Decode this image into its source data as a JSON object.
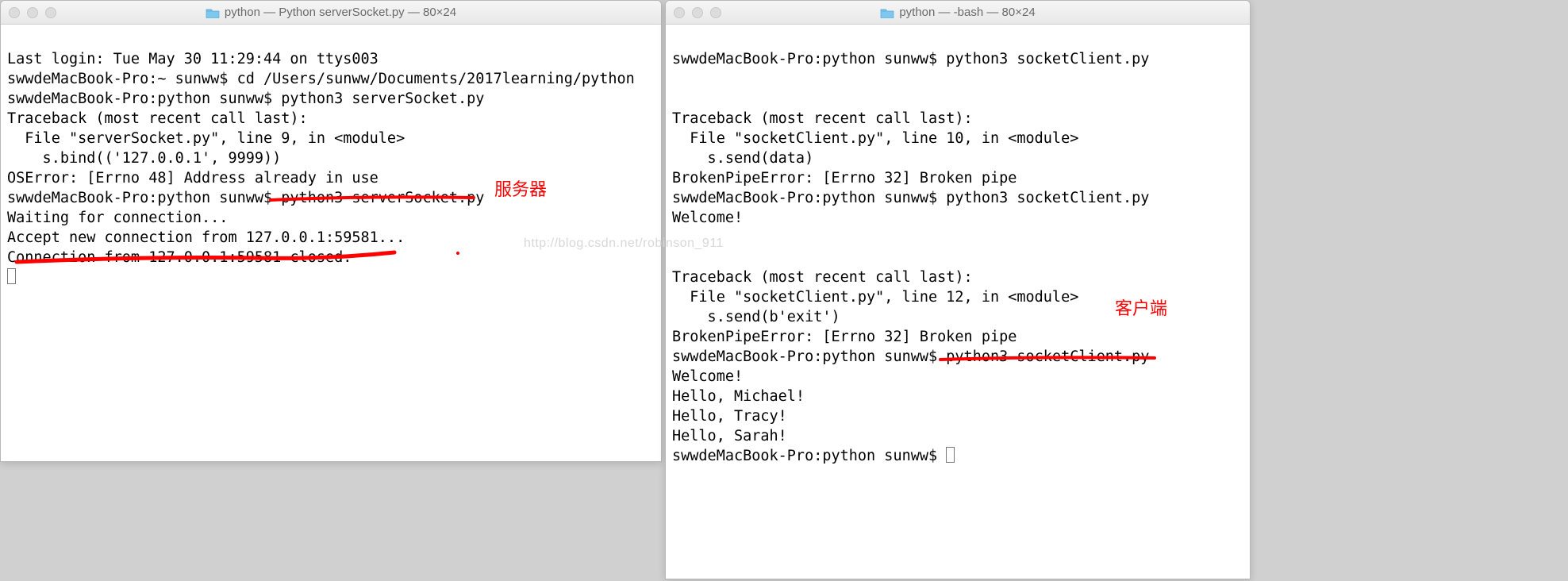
{
  "left": {
    "title": "python — Python serverSocket.py — 80×24",
    "lines": {
      "l1": "Last login: Tue May 30 11:29:44 on ttys003",
      "l2": "swwdeMacBook-Pro:~ sunww$ cd /Users/sunww/Documents/2017learning/python",
      "l3": "swwdeMacBook-Pro:python sunww$ python3 serverSocket.py",
      "l4": "Traceback (most recent call last):",
      "l5": "  File \"serverSocket.py\", line 9, in <module>",
      "l6": "    s.bind(('127.0.0.1', 9999))",
      "l7": "OSError: [Errno 48] Address already in use",
      "l8": "swwdeMacBook-Pro:python sunww$ python3 serverSocket.py",
      "l9": "Waiting for connection...",
      "l10": "Accept new connection from 127.0.0.1:59581...",
      "l11": "Connection from 127.0.0.1:59581 closed."
    },
    "annotation": "服务器"
  },
  "right": {
    "title": "python — -bash — 80×24",
    "lines": {
      "l1": "swwdeMacBook-Pro:python sunww$ python3 socketClient.py",
      "blank1": "",
      "blank2": "",
      "l2": "Traceback (most recent call last):",
      "l3": "  File \"socketClient.py\", line 10, in <module>",
      "l4": "    s.send(data)",
      "l5": "BrokenPipeError: [Errno 32] Broken pipe",
      "l6": "swwdeMacBook-Pro:python sunww$ python3 socketClient.py",
      "l7": "Welcome!",
      "blank3": "",
      "blank4": "",
      "l8": "Traceback (most recent call last):",
      "l9": "  File \"socketClient.py\", line 12, in <module>",
      "l10": "    s.send(b'exit')",
      "l11": "BrokenPipeError: [Errno 32] Broken pipe",
      "l12": "swwdeMacBook-Pro:python sunww$ python3 socketClient.py",
      "l13": "Welcome!",
      "l14": "Hello, Michael!",
      "l15": "Hello, Tracy!",
      "l16": "Hello, Sarah!",
      "l17": "swwdeMacBook-Pro:python sunww$ "
    },
    "annotation": "客户端"
  },
  "watermark": "http://blog.csdn.net/robinson_911"
}
